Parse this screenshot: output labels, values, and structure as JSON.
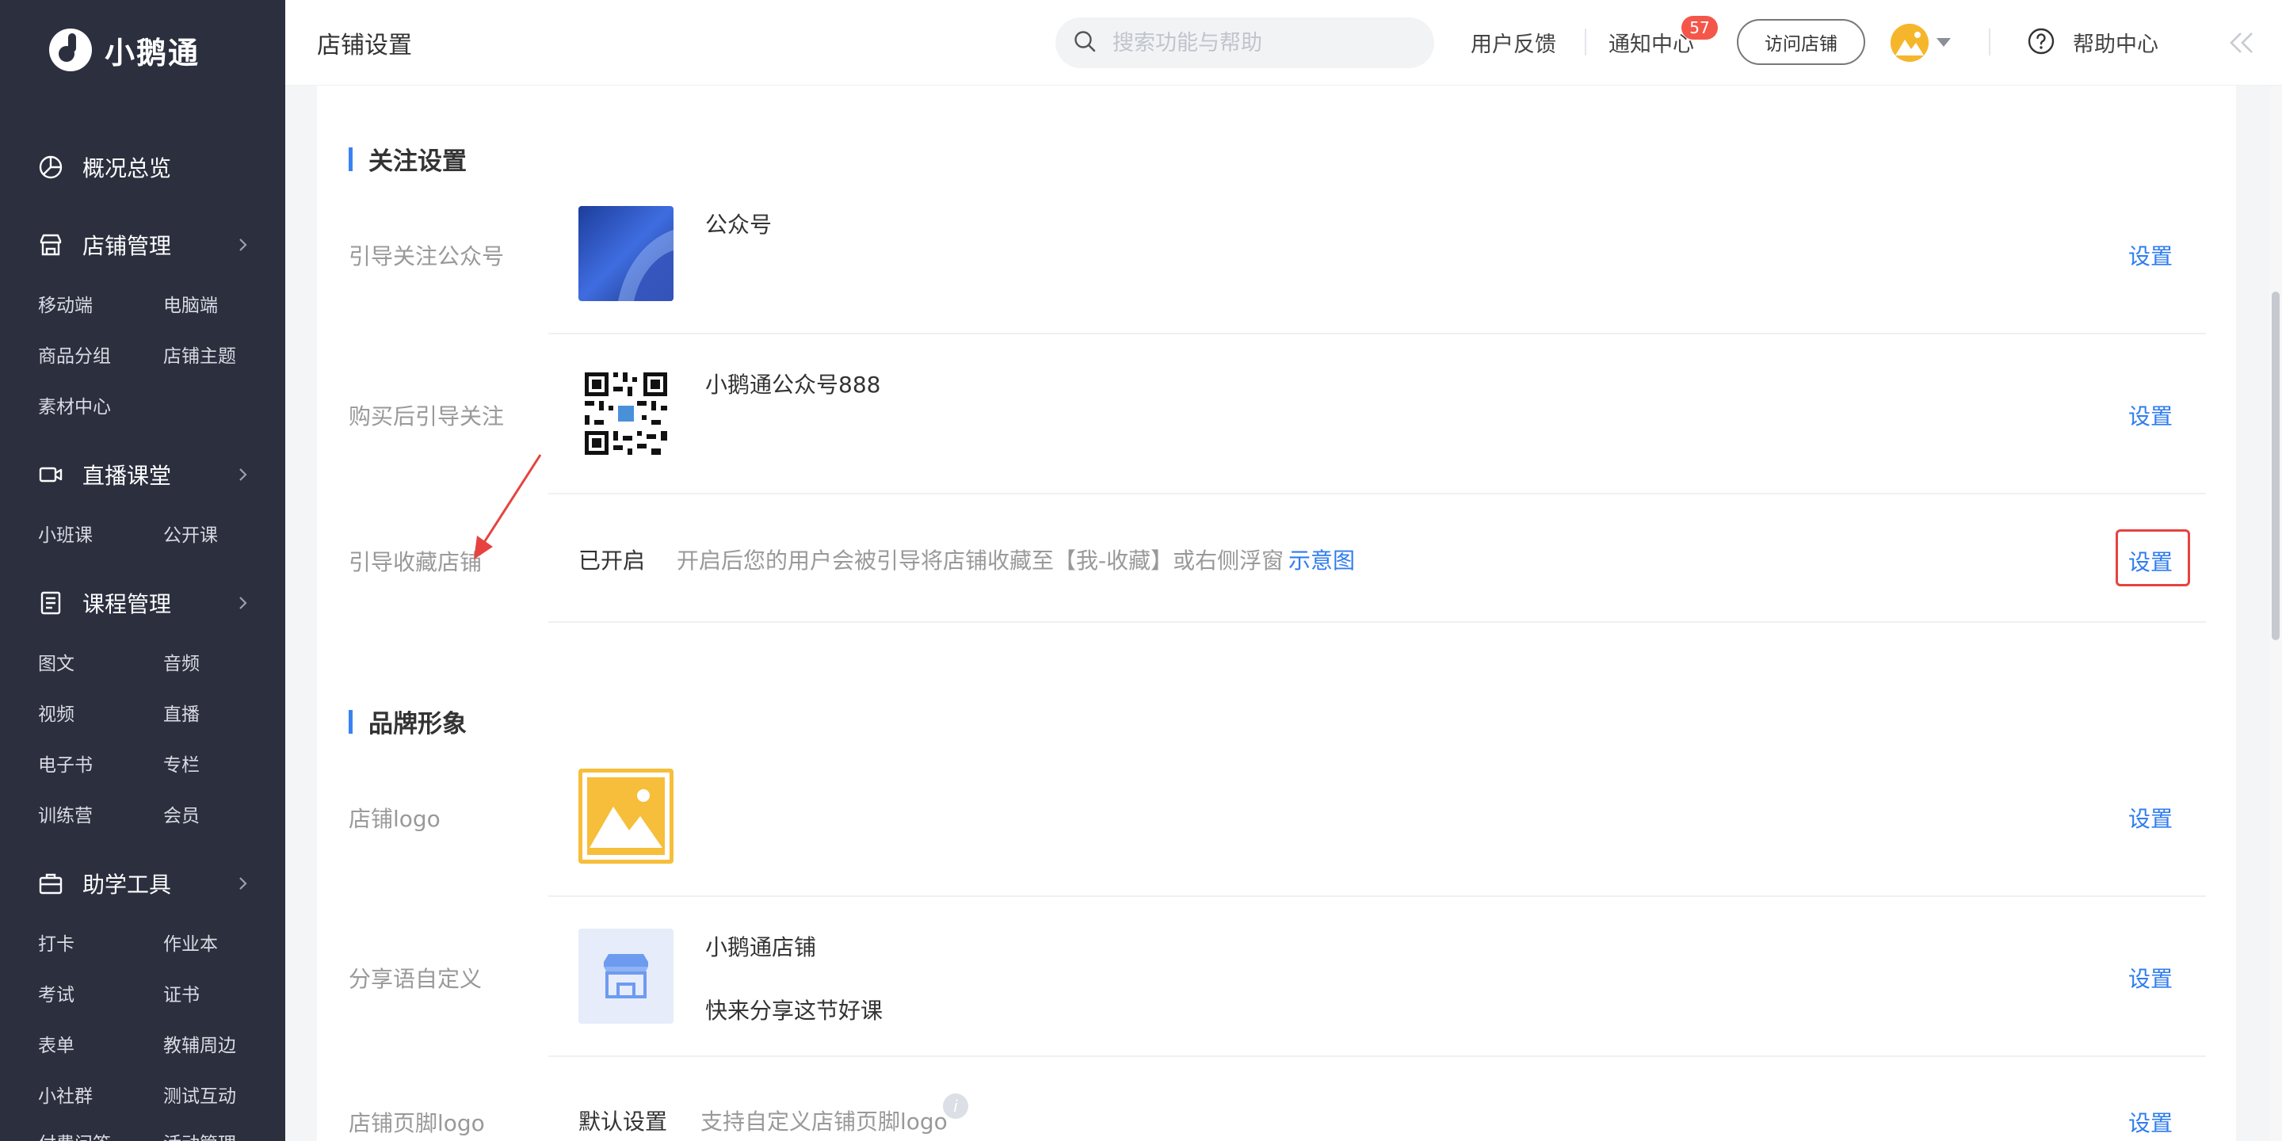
{
  "brand": {
    "name": "小鹅通"
  },
  "sidebar": {
    "overview": "概况总览",
    "shop": {
      "label": "店铺管理",
      "items": [
        "移动端",
        "电脑端",
        "商品分组",
        "店铺主题",
        "素材中心"
      ]
    },
    "live": {
      "label": "直播课堂",
      "items": [
        "小班课",
        "公开课"
      ]
    },
    "course": {
      "label": "课程管理",
      "items": [
        "图文",
        "音频",
        "视频",
        "直播",
        "电子书",
        "专栏",
        "训练营",
        "会员"
      ]
    },
    "tools": {
      "label": "助学工具",
      "items": [
        "打卡",
        "作业本",
        "考试",
        "证书",
        "表单",
        "教辅周边",
        "小社群",
        "测试互动",
        "付费问答",
        "活动管理"
      ]
    }
  },
  "topbar": {
    "title": "店铺设置",
    "search_placeholder": "搜索功能与帮助",
    "feedback": "用户反馈",
    "notifications": "通知中心",
    "notification_count": "57",
    "visit_shop": "访问店铺",
    "help_center": "帮助中心"
  },
  "follow": {
    "title": "关注设置",
    "rows": [
      {
        "label": "引导关注公众号",
        "name": "公众号",
        "action": "设置"
      },
      {
        "label": "购买后引导关注",
        "name": "小鹅通公众号888",
        "action": "设置"
      },
      {
        "label": "引导收藏店铺",
        "status": "已开启",
        "hint": "开启后您的用户会被引导将店铺收藏至【我-收藏】或右侧浮窗",
        "link": "示意图",
        "action": "设置"
      }
    ]
  },
  "brand_image": {
    "title": "品牌形象",
    "rows": [
      {
        "label": "店铺logo",
        "action": "设置"
      },
      {
        "label": "分享语自定义",
        "name": "小鹅通店铺",
        "desc": "快来分享这节好课",
        "action": "设置"
      },
      {
        "label": "店铺页脚logo",
        "status": "默认设置",
        "hint": "支持自定义店铺页脚logo",
        "action": "设置"
      }
    ]
  },
  "colors": {
    "sidebar_bg": "#2b2f3e",
    "accent_blue": "#2f7cf0",
    "badge_red": "#f5564a",
    "highlight_red": "#e64340"
  }
}
